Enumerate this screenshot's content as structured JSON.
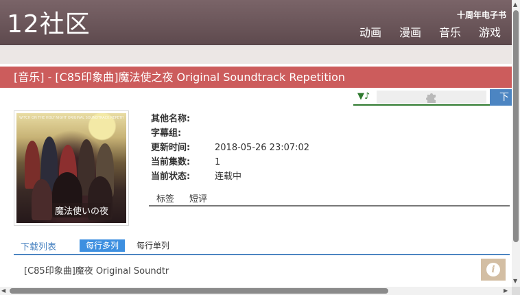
{
  "header": {
    "logo": "12社区",
    "top_link": "十周年电子书",
    "nav": [
      "动画",
      "漫画",
      "音乐",
      "游戏"
    ]
  },
  "title": "[音乐] - [C85印象曲]魔法使之夜 Original Soundtrack Repetition",
  "player": {
    "toggle": "▼♪",
    "plugin_icon": "puzzle-icon"
  },
  "download_tab": "下",
  "cover": {
    "caption": "魔法使いの夜",
    "topline": "WITCH ON THE HOLY NIGHT ORIGINAL SOUNDTRACK REPETITION"
  },
  "info": [
    {
      "label": "其他名称:",
      "value": ""
    },
    {
      "label": "字幕组:",
      "value": ""
    },
    {
      "label": "更新时间:",
      "value": "2018-05-26 23:07:02"
    },
    {
      "label": "当前集数:",
      "value": "1"
    },
    {
      "label": "当前状态:",
      "value": "连载中"
    }
  ],
  "tabs": [
    "标签",
    "短评"
  ],
  "download": {
    "title": "下载列表",
    "options": [
      "每行多列",
      "每行单列"
    ],
    "active_option": "每行多列",
    "items": [
      "[C85印象曲]魔夜 Original Soundtr"
    ]
  },
  "colors": {
    "header": "#6c5559",
    "title_bar": "#cc5c5c",
    "accent_blue": "#4c85c2",
    "player_green": "#2f7a2f",
    "info_button": "#d3bea3"
  }
}
